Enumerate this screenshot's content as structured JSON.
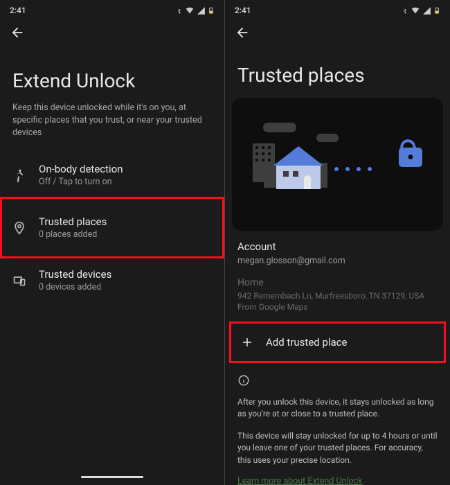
{
  "status": {
    "time": "2:41"
  },
  "left": {
    "title": "Extend Unlock",
    "subtitle": "Keep this device unlocked while it's on you, at specific places that you trust, or near your trusted devices",
    "items": [
      {
        "label": "On-body detection",
        "sub": "Off / Tap to turn on"
      },
      {
        "label": "Trusted places",
        "sub": "0 places added"
      },
      {
        "label": "Trusted devices",
        "sub": "0 devices added"
      }
    ]
  },
  "right": {
    "title": "Trusted places",
    "account_label": "Account",
    "account_value": "megan.glosson@gmail.com",
    "home_label": "Home",
    "home_address": "942 Remembach Ln, Murfreesboro, TN 37129, USA",
    "home_source": "From Google Maps",
    "add_label": "Add trusted place",
    "info1": "After you unlock this device, it stays unlocked as long as you're at or close to a trusted place.",
    "info2": "This device will stay unlocked for up to 4 hours or until you leave one of your trusted places. For accuracy, this uses your precise location.",
    "learn_more": "Learn more about Extend Unlock"
  }
}
